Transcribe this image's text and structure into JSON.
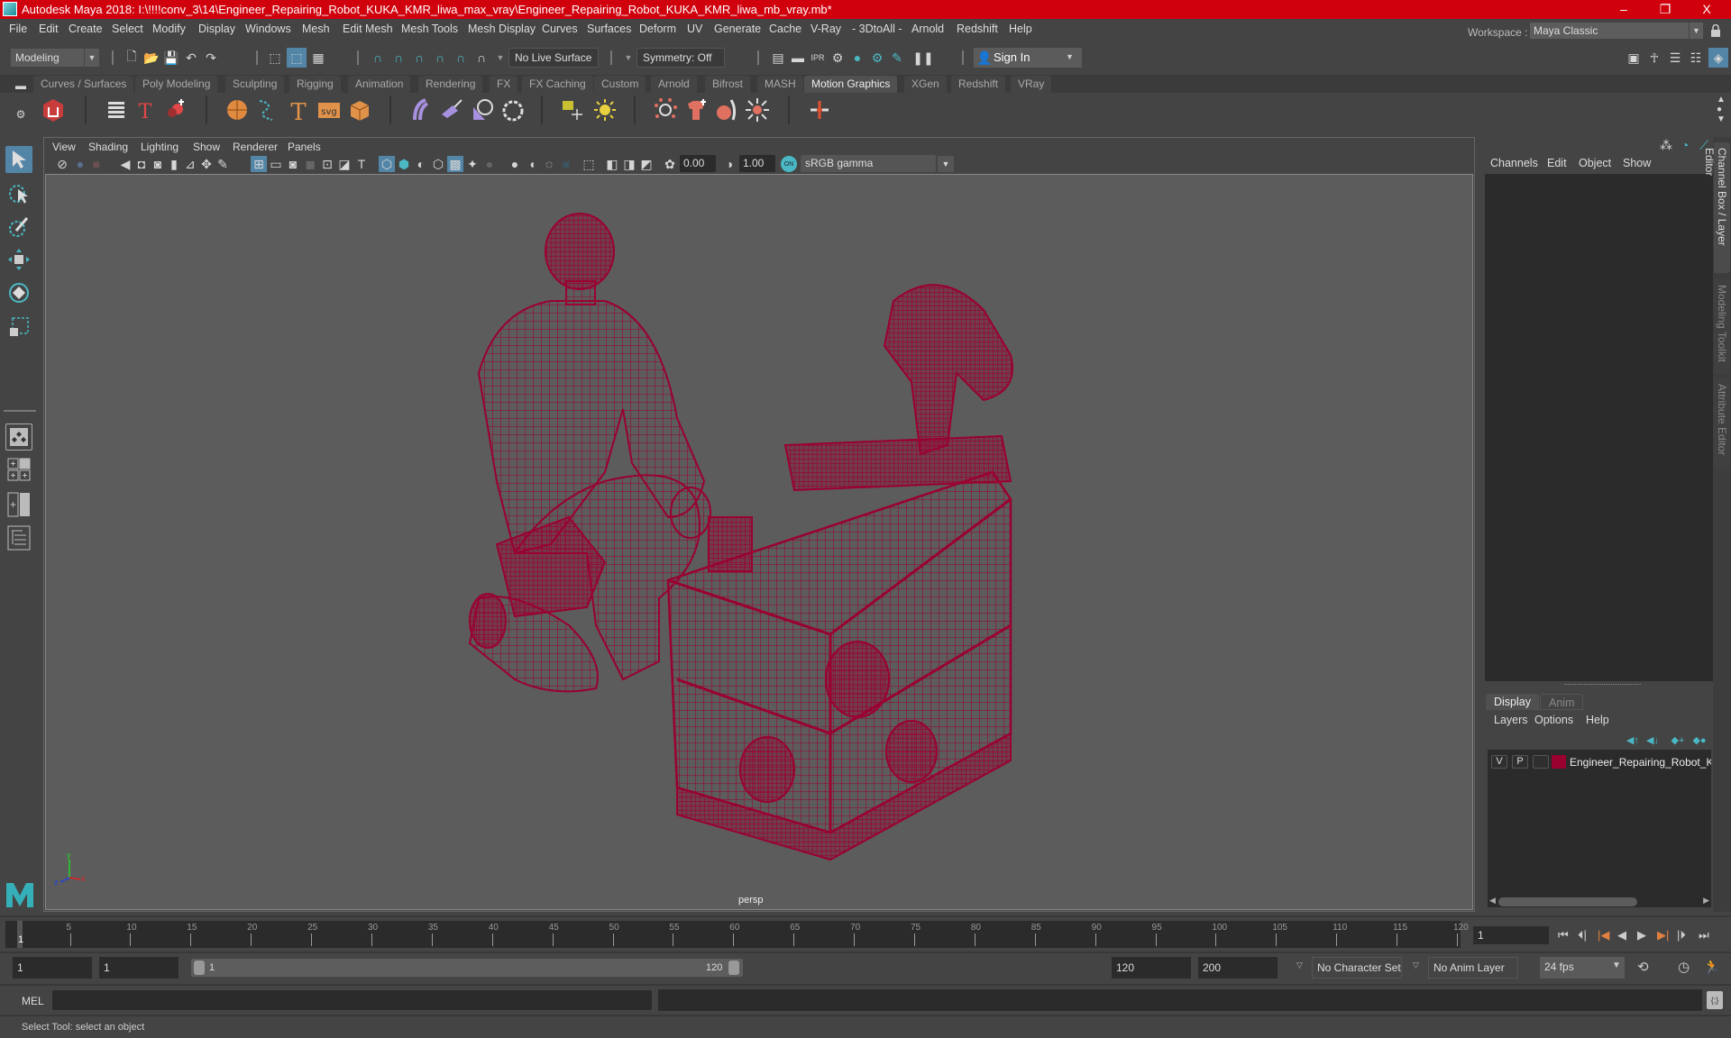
{
  "window": {
    "title": "Autodesk Maya 2018: I:\\!!!!conv_3\\14\\Engineer_Repairing_Robot_KUKA_KMR_liwa_max_vray\\Engineer_Repairing_Robot_KUKA_KMR_liwa_mb_vray.mb*",
    "controls": {
      "minimize": "–",
      "maximize": "❐",
      "close": "X"
    }
  },
  "menubar": {
    "items": [
      "File",
      "Edit",
      "Create",
      "Select",
      "Modify",
      "Display",
      "Windows",
      "Mesh",
      "Edit Mesh",
      "Mesh Tools",
      "Mesh Display",
      "Curves",
      "Surfaces",
      "Deform",
      "UV",
      "Generate",
      "Cache",
      "V-Ray",
      "- 3DtoAll -",
      "Arnold",
      "Redshift",
      "Help"
    ],
    "workspace_label": "Workspace :",
    "workspace_value": "Maya Classic"
  },
  "statusline": {
    "mode": "Modeling",
    "live_surface": "No Live Surface",
    "symmetry": "Symmetry: Off",
    "sign_in": "Sign In"
  },
  "shelf": {
    "tabs": [
      "Curves / Surfaces",
      "Poly Modeling",
      "Sculpting",
      "Rigging",
      "Animation",
      "Rendering",
      "FX",
      "FX Caching",
      "Custom",
      "Arnold",
      "Bifrost",
      "MASH",
      "Motion Graphics",
      "XGen",
      "Redshift",
      "VRay"
    ],
    "active_tab": "Motion Graphics"
  },
  "viewport": {
    "menu": [
      "View",
      "Shading",
      "Lighting",
      "Show",
      "Renderer",
      "Panels"
    ],
    "exposure": "0.00",
    "gamma": "1.00",
    "color_space": "sRGB gamma",
    "camera_label": "persp",
    "wireframe_color": "#9a0030",
    "axis": {
      "x": "x",
      "y": "y",
      "z": "z"
    }
  },
  "channel_box": {
    "menu": [
      "Channels",
      "Edit",
      "Object",
      "Show"
    ]
  },
  "layer_editor": {
    "tabs": [
      "Display",
      "Anim"
    ],
    "active_tab": "Display",
    "menu": [
      "Layers",
      "Options",
      "Help"
    ],
    "layers": [
      {
        "visible": "V",
        "playback": "P",
        "color": "#9a0030",
        "name": "Engineer_Repairing_Robot_KUKA_KMR_liwa"
      }
    ]
  },
  "side_tabs": [
    "Channel Box / Layer Editor",
    "Modeling Toolkit",
    "Attribute Editor"
  ],
  "timeline": {
    "ticks": [
      5,
      10,
      15,
      20,
      25,
      30,
      35,
      40,
      45,
      50,
      55,
      60,
      65,
      70,
      75,
      80,
      85,
      90,
      95,
      100,
      105,
      110,
      115,
      120
    ],
    "current_frame_marker": "1",
    "current_frame": "1",
    "start": 1,
    "end": 120
  },
  "range": {
    "anim_start": "1",
    "playback_start": "1",
    "slider_start": "1",
    "slider_end": "120",
    "playback_end": "120",
    "anim_end": "200",
    "character_set": "No Character Set",
    "anim_layer": "No Anim Layer",
    "fps": "24 fps"
  },
  "command_line": {
    "label": "MEL",
    "value": ""
  },
  "status_bar": {
    "message": "Select Tool: select an object"
  }
}
